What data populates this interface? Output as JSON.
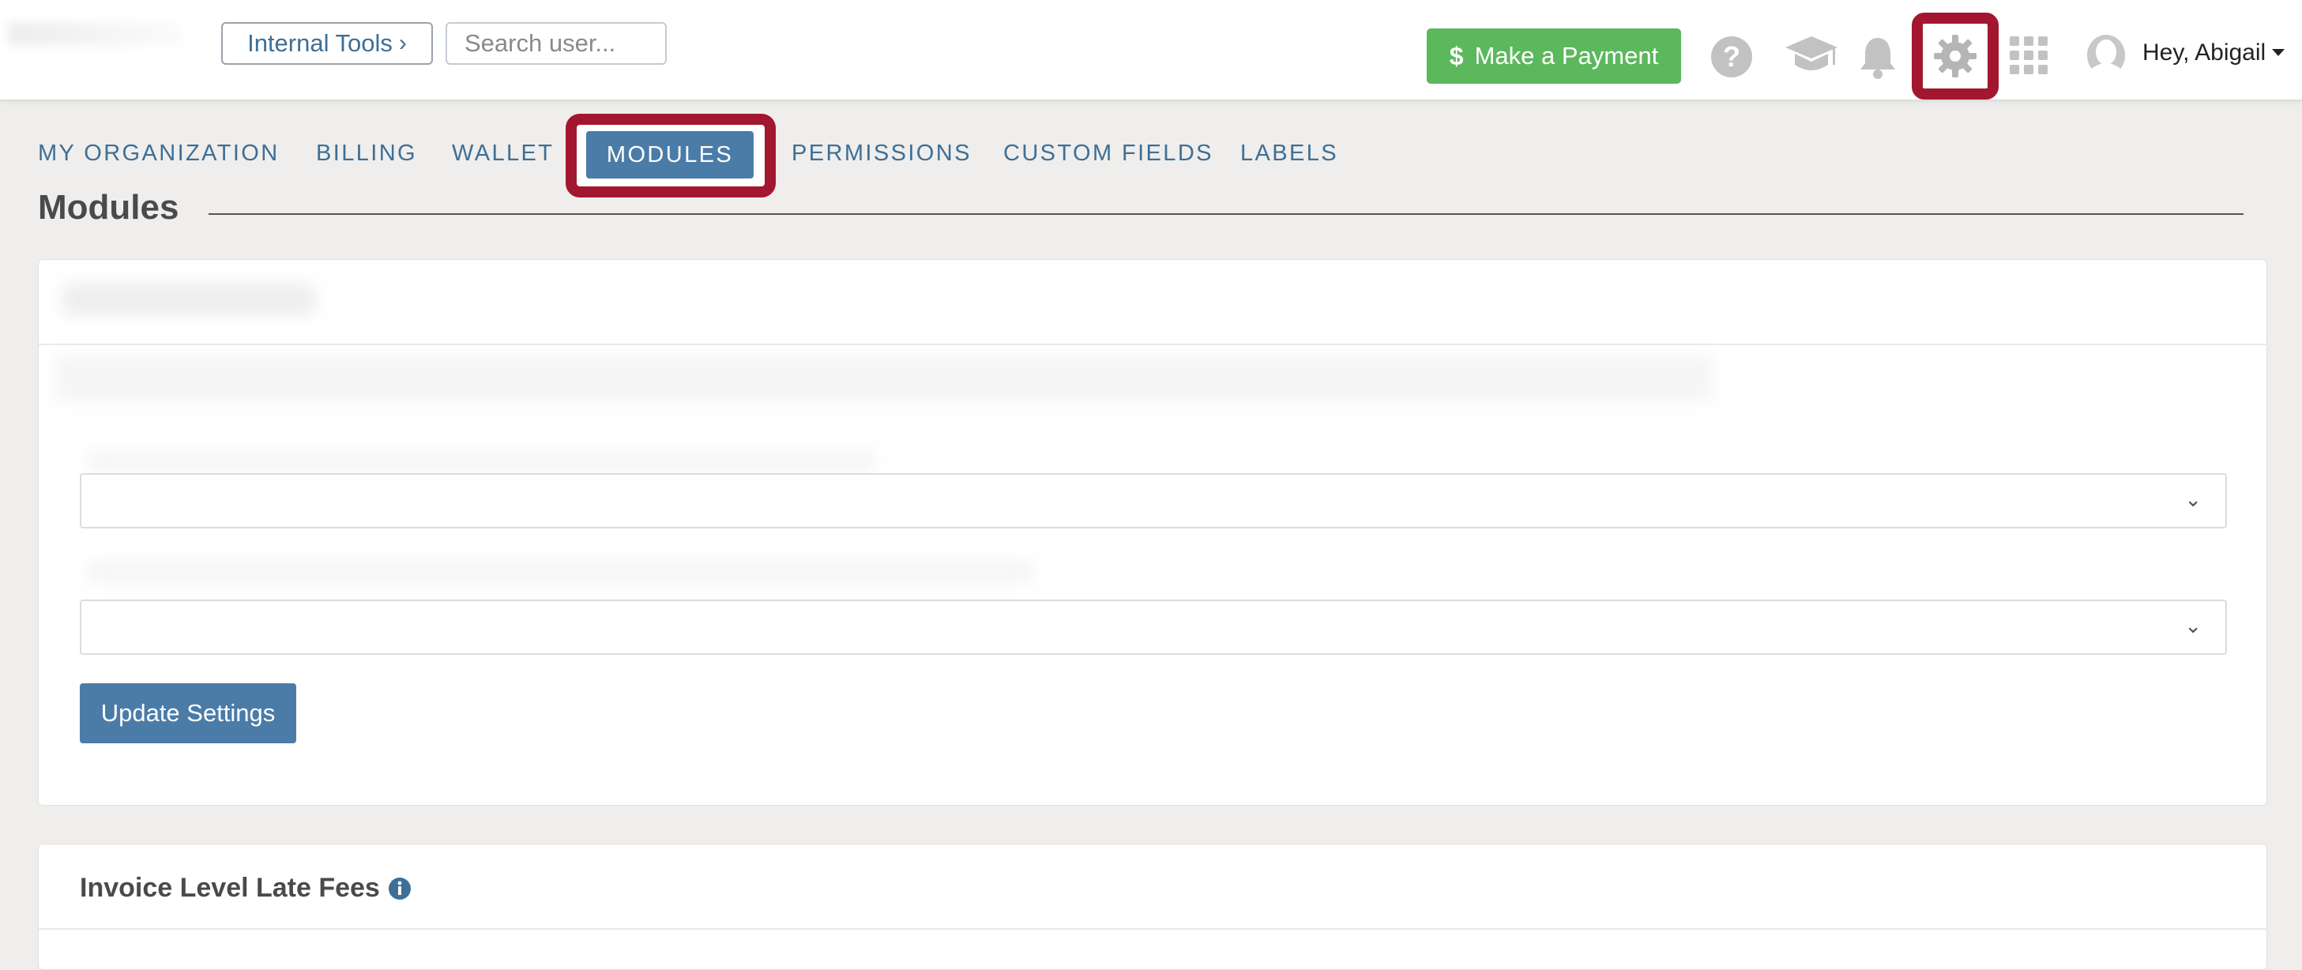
{
  "header": {
    "internal_tools_label": "Internal Tools",
    "internal_tools_chevron": "›",
    "search_placeholder": "Search user...",
    "payment_icon": "$",
    "payment_label": "Make a Payment",
    "user_greeting": "Hey, Abigail",
    "icons": [
      "help-icon",
      "graduation-cap-icon",
      "bell-icon",
      "gear-icon",
      "apps-grid-icon",
      "avatar-icon"
    ]
  },
  "tabs": [
    {
      "label": "MY ORGANIZATION"
    },
    {
      "label": "BILLING"
    },
    {
      "label": "WALLET"
    },
    {
      "label": "MODULES",
      "active": true
    },
    {
      "label": "PERMISSIONS"
    },
    {
      "label": "CUSTOM FIELDS"
    },
    {
      "label": "LABELS"
    }
  ],
  "page": {
    "title": "Modules"
  },
  "settings_card": {
    "update_button_label": "Update Settings"
  },
  "late_fees_card": {
    "title": "Invoice Level Late Fees"
  },
  "colors": {
    "accent_blue": "#4b7ca8",
    "link_blue": "#3d6f97",
    "success_green": "#5cb85c",
    "highlight_red": "#a3162f",
    "background": "#efeeec"
  }
}
